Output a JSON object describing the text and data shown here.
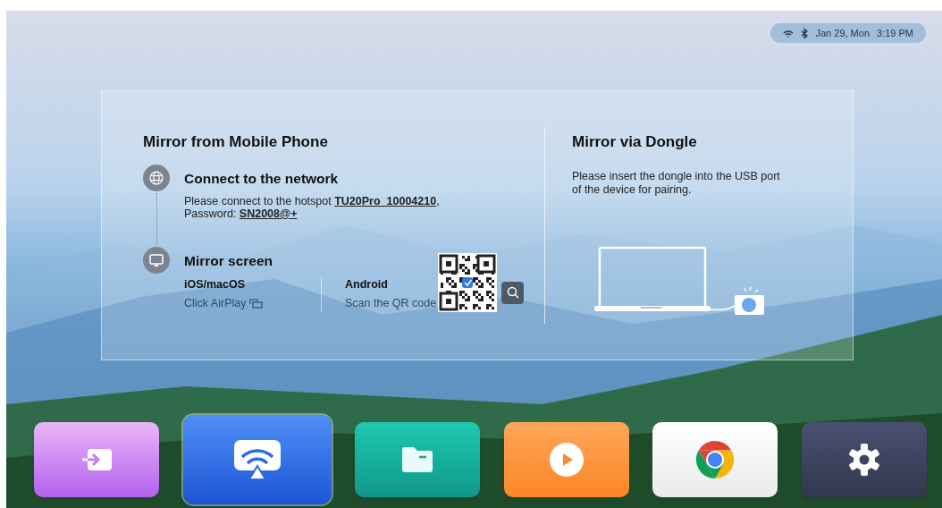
{
  "status_bar": {
    "date": "Jan 29, Mon",
    "time": "3:19 PM"
  },
  "mobile": {
    "title": "Mirror from Mobile Phone",
    "steps": [
      {
        "kind": "network",
        "title": "Connect to the network",
        "text": "Please connect to the hotspot **TU20Pro_10004210**,\nPassword: **SN2008@+**"
      },
      {
        "kind": "screen",
        "title": "Mirror screen"
      }
    ],
    "options": [
      {
        "kind": "airplay",
        "title": "iOS/macOS",
        "text": "Click AirPlay"
      },
      {
        "kind": "qr",
        "title": "Android",
        "text": "Scan the QR code"
      }
    ]
  },
  "dongle": {
    "title": "Mirror via Dongle",
    "text": "Please insert the dongle into the USB port\nof the device for pairing."
  },
  "dock": [
    {
      "kind": "input",
      "selected": false
    },
    {
      "kind": "mirror",
      "selected": true
    },
    {
      "kind": "files",
      "selected": false
    },
    {
      "kind": "video",
      "selected": false
    },
    {
      "kind": "browser",
      "selected": false
    },
    {
      "kind": "settings",
      "selected": false
    }
  ]
}
